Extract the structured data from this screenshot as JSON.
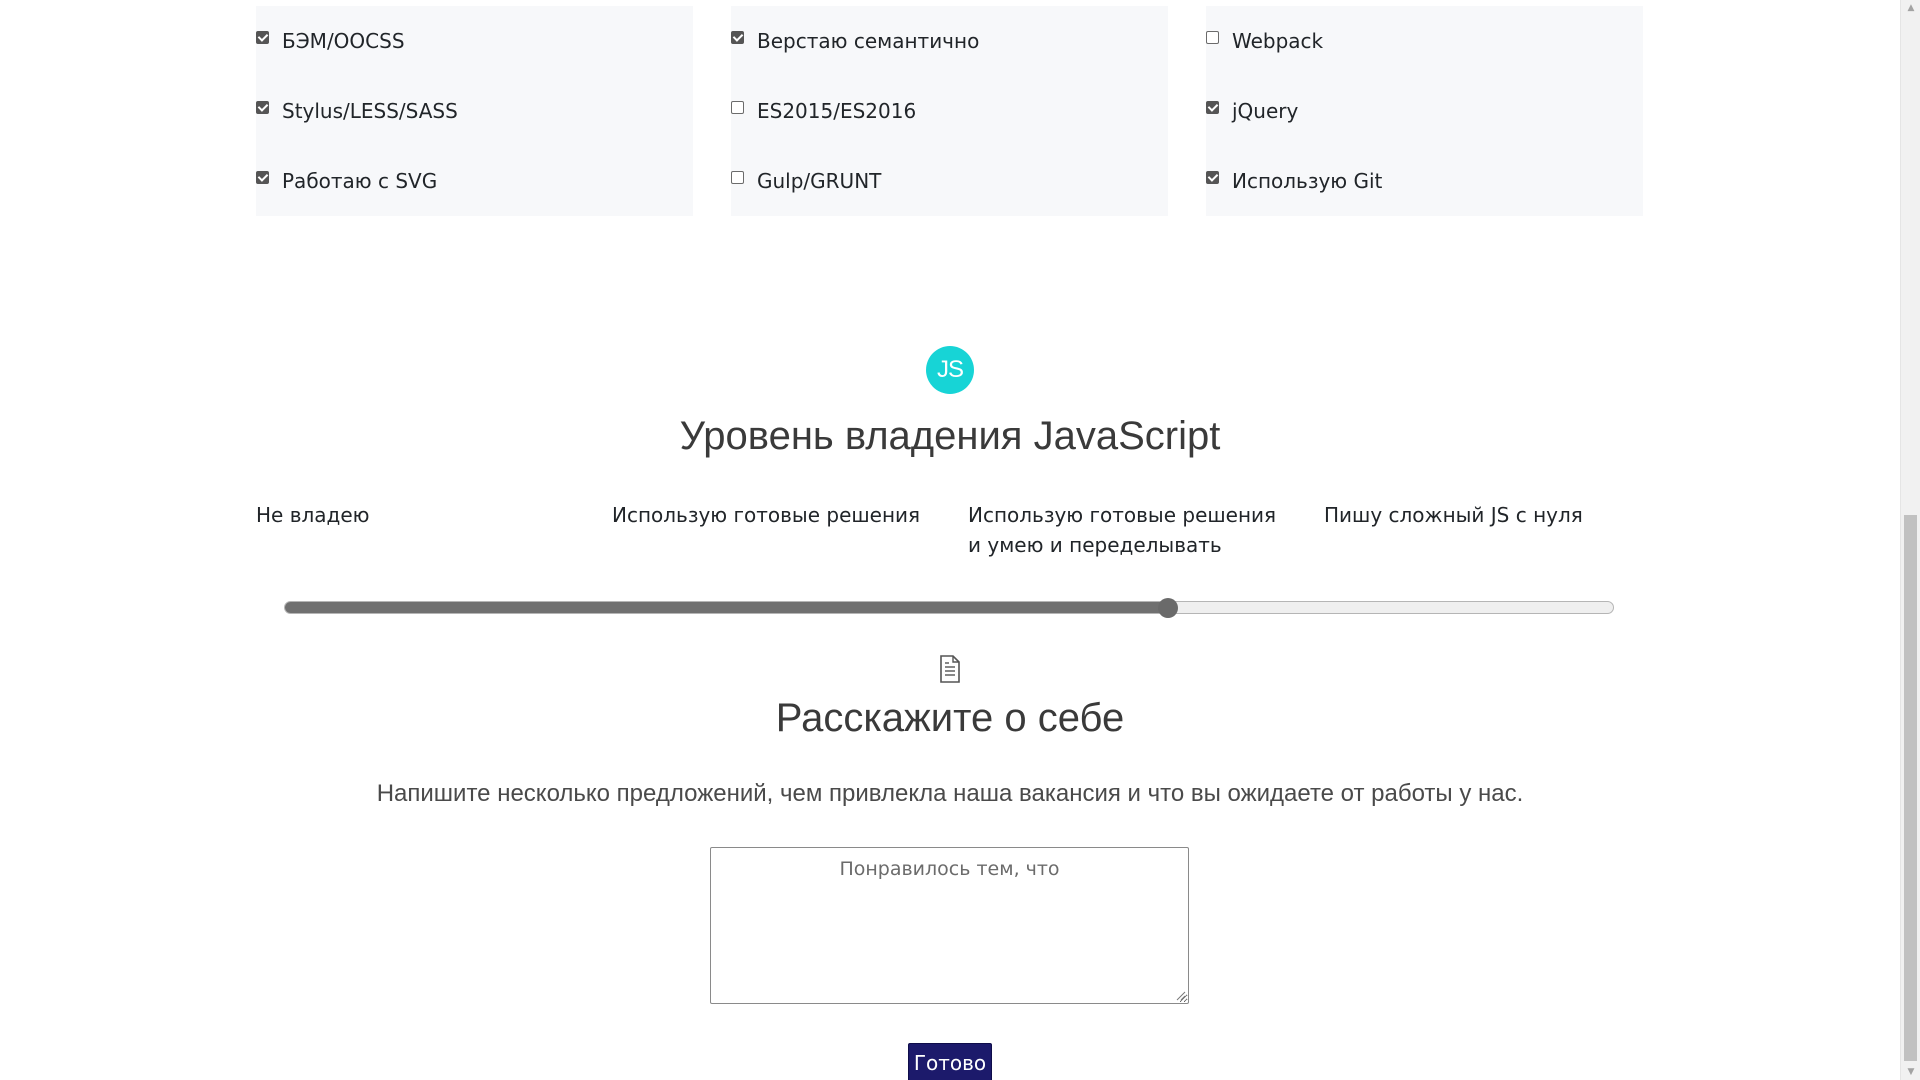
{
  "skills": {
    "columns": [
      [
        {
          "label": "БЭМ/OOCSS",
          "checked": true
        },
        {
          "label": "Stylus/LESS/SASS",
          "checked": true
        },
        {
          "label": "Работаю с SVG",
          "checked": true
        }
      ],
      [
        {
          "label": "Верстаю семантично",
          "checked": true
        },
        {
          "label": "ES2015/ES2016",
          "checked": false
        },
        {
          "label": "Gulp/GRUNT",
          "checked": false
        }
      ],
      [
        {
          "label": "Webpack",
          "checked": false
        },
        {
          "label": "jQuery",
          "checked": true
        },
        {
          "label": "Использую Git",
          "checked": true
        }
      ]
    ]
  },
  "js_section": {
    "badge": "JS",
    "title": "Уровень владения JavaScript",
    "levels": [
      "Не владею",
      "Использую готовые решения",
      "Использую готовые решения и умею и переделывать",
      "Пишу сложный JS с нуля"
    ],
    "slider_value_fraction": 0.665
  },
  "about": {
    "icon": "document-icon",
    "title": "Расскажите о себе",
    "description": "Напишите несколько предложений, чем привлекла наша вакансия и что вы ожидаете от работы у нас.",
    "textarea_placeholder": "Понравилось тем, что",
    "submit_label": "Готово"
  },
  "colors": {
    "js_badge": "#17d4d6",
    "submit_button": "#1c1a6b",
    "column_background": "#f7f8fa"
  }
}
